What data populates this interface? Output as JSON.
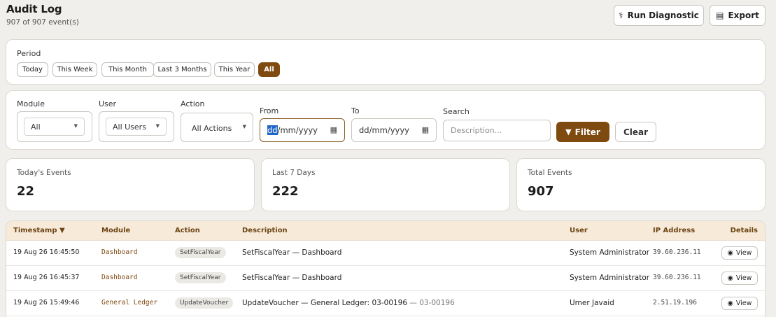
{
  "header": {
    "title": "Audit Log",
    "count": "907 of 907 event(s)",
    "run_diagnostic_label": "Run Diagnostic",
    "export_label": "Export"
  },
  "period": {
    "label": "Period",
    "options": [
      "Today",
      "This Week",
      "This Month",
      "Last 3 Months",
      "This Year",
      "All"
    ],
    "selected": "All"
  },
  "filters": {
    "module_label": "Module",
    "module_value": "All",
    "user_label": "User",
    "user_value": "All Users",
    "action_label": "Action",
    "action_value": "All Actions",
    "from_label": "From",
    "from_sel": "dd",
    "from_rest": "/mm/yyyy",
    "to_label": "To",
    "to_value": "dd/mm/yyyy",
    "search_label": "Search",
    "search_placeholder": "Description...",
    "filter_label": "Filter",
    "clear_label": "Clear"
  },
  "stats": [
    {
      "label": "Today's Events",
      "value": "22"
    },
    {
      "label": "Last 7 Days",
      "value": "222"
    },
    {
      "label": "Total Events",
      "value": "907"
    }
  ],
  "table": {
    "columns": [
      "Timestamp ▼",
      "Module",
      "Action",
      "Description",
      "User",
      "IP Address",
      "Details"
    ],
    "rows": [
      {
        "timestamp": "19 Aug 26 16:45:50",
        "module": "Dashboard",
        "action": "SetFiscalYear",
        "description": "SetFiscalYear — Dashboard",
        "description_extra": "",
        "user": "System Administrator",
        "ip": "39.60.236.11",
        "view": "View"
      },
      {
        "timestamp": "19 Aug 26 16:45:37",
        "module": "Dashboard",
        "action": "SetFiscalYear",
        "description": "SetFiscalYear — Dashboard",
        "description_extra": "",
        "user": "System Administrator",
        "ip": "39.60.236.11",
        "view": "View"
      },
      {
        "timestamp": "19 Aug 26 15:49:46",
        "module": "General Ledger",
        "action": "UpdateVoucher",
        "description": "UpdateVoucher — General Ledger: 03-00196",
        "description_extra": "— 03-00196",
        "user": "Umer Javaid",
        "ip": "2.51.19.196",
        "view": "View"
      }
    ]
  },
  "colors": {
    "accent": "#7f4a10",
    "header_bg": "#f8ead8",
    "page_bg": "#f0efeb"
  }
}
